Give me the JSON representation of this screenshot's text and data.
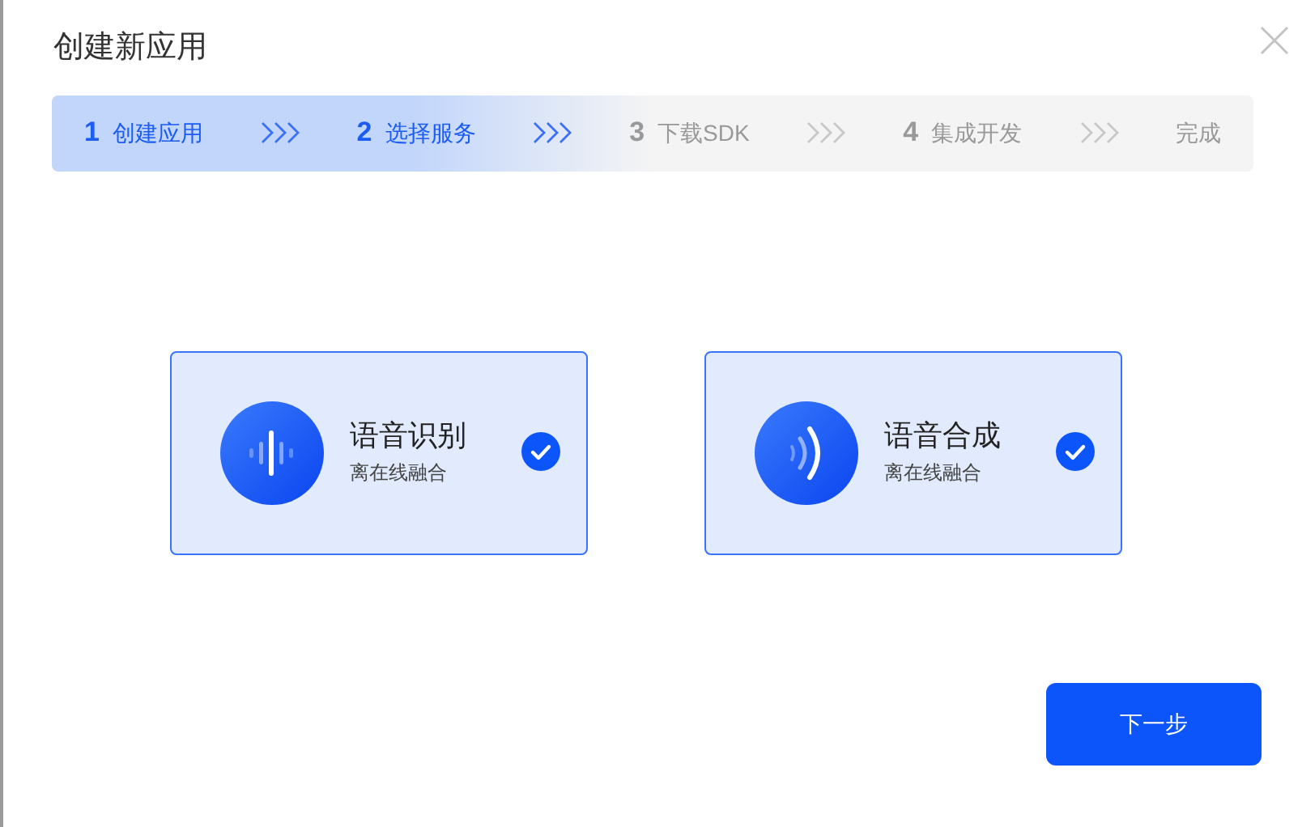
{
  "dialog": {
    "title": "创建新应用"
  },
  "steps": [
    {
      "number": "1",
      "label": "创建应用",
      "active": true
    },
    {
      "number": "2",
      "label": "选择服务",
      "active": true
    },
    {
      "number": "3",
      "label": "下载SDK",
      "active": false
    },
    {
      "number": "4",
      "label": "集成开发",
      "active": false
    },
    {
      "label": "完成",
      "active": false
    }
  ],
  "services": [
    {
      "kind": "recognition",
      "name": "语音识别",
      "subtitle": "离在线融合",
      "selected": true
    },
    {
      "kind": "synthesis",
      "name": "语音合成",
      "subtitle": "离在线融合",
      "selected": true
    }
  ],
  "buttons": [
    {
      "label": "下一步"
    }
  ]
}
